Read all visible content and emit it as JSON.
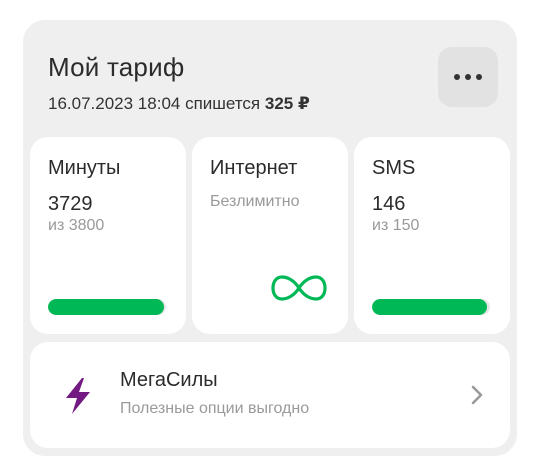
{
  "header": {
    "title": "Мой тариф",
    "charge_date": "16.07.2023 18:04",
    "charge_text": "спишется",
    "charge_amount": "325 ₽"
  },
  "menu": {
    "icon": "more-horizontal-icon"
  },
  "tiles": [
    {
      "title": "Минуты",
      "value": "3729",
      "sub": "из 3800",
      "remaining_fraction": 0.981
    },
    {
      "title": "Интернет",
      "sub": "Безлимитно",
      "icon": "infinity-icon"
    },
    {
      "title": "SMS",
      "value": "146",
      "sub": "из 150",
      "remaining_fraction": 0.973
    }
  ],
  "megasily": {
    "title": "МегаСилы",
    "subtitle": "Полезные опции выгодно",
    "icon": "lightning-icon",
    "chevron": "chevron-right-icon"
  },
  "colors": {
    "card_bg": "#efefef",
    "tile_bg": "#ffffff",
    "accent_green": "#00b956",
    "accent_purple": "#731982",
    "text_primary": "#2b2b2b",
    "text_secondary": "#9a9a9a"
  }
}
